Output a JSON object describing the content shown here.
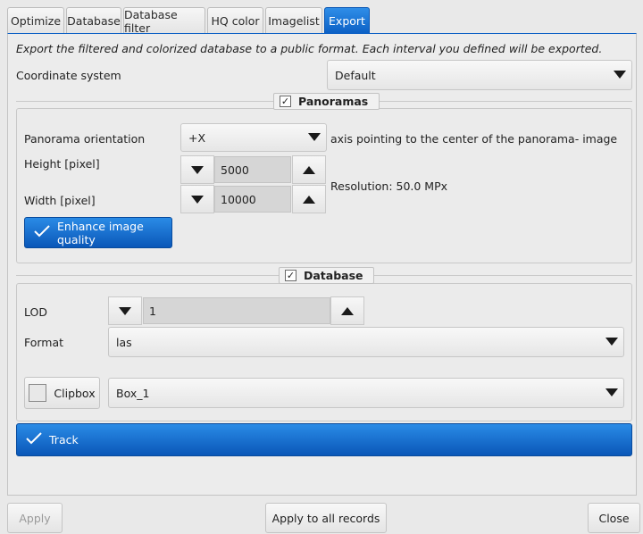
{
  "tabs": [
    {
      "label": "Optimize",
      "active": false
    },
    {
      "label": "Database",
      "active": false
    },
    {
      "label": "Database filter",
      "active": false
    },
    {
      "label": "HQ color",
      "active": false
    },
    {
      "label": "Imagelist",
      "active": false
    },
    {
      "label": "Export",
      "active": true
    }
  ],
  "export": {
    "description": "Export the filtered and colorized database to a public format. Each interval you defined will be exported.",
    "coordinate_system": {
      "label": "Coordinate system",
      "value": "Default"
    }
  },
  "panoramas": {
    "title": "Panoramas",
    "checked": true,
    "orientation": {
      "label": "Panorama orientation",
      "value": "+X",
      "hint": "axis pointing to the center of the panorama- image"
    },
    "height": {
      "label": "Height [pixel]",
      "value": "5000"
    },
    "width": {
      "label": "Width [pixel]",
      "value": "10000"
    },
    "resolution": "Resolution: 50.0 MPx",
    "enhance": {
      "label": "Enhance image quality",
      "checked": true
    }
  },
  "database": {
    "title": "Database",
    "checked": true,
    "lod": {
      "label": "LOD",
      "value": "1"
    },
    "format": {
      "label": "Format",
      "value": "las"
    },
    "clipbox": {
      "label": "Clipbox",
      "checked": false,
      "value": "Box_1"
    },
    "track": {
      "label": "Track",
      "checked": true
    }
  },
  "footer": {
    "apply": "Apply",
    "apply_all": "Apply to all records",
    "close": "Close"
  },
  "colors": {
    "accent": "#0b5fc4",
    "background": "#e9e9e9"
  }
}
